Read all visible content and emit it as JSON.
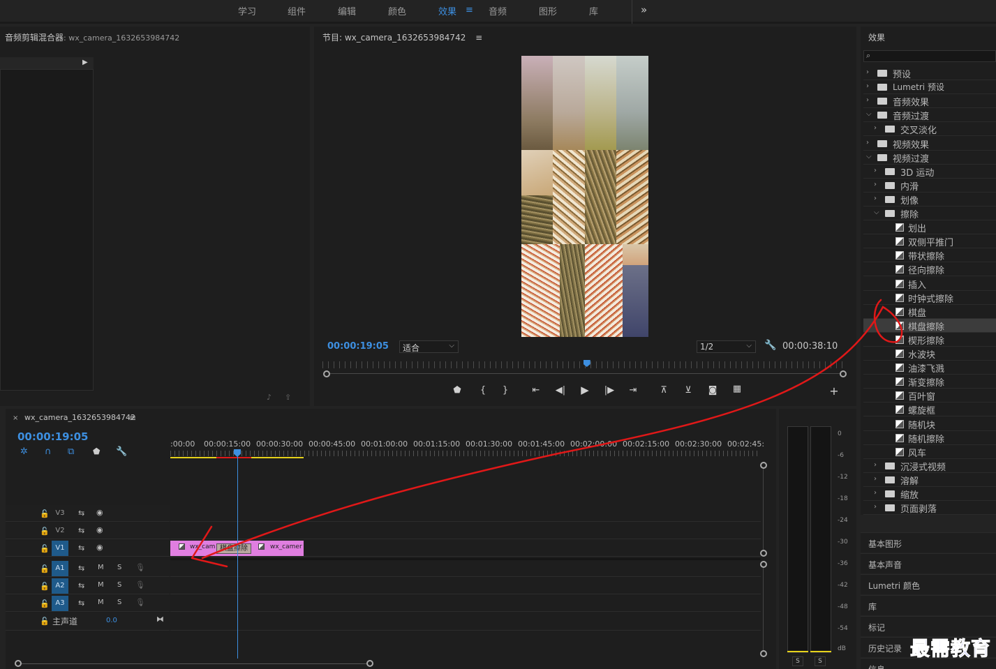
{
  "workspace": {
    "tabs": [
      {
        "label": "学习",
        "active": false
      },
      {
        "label": "组件",
        "active": false
      },
      {
        "label": "编辑",
        "active": false
      },
      {
        "label": "颜色",
        "active": false
      },
      {
        "label": "效果",
        "active": true
      },
      {
        "label": "音频",
        "active": false
      },
      {
        "label": "图形",
        "active": false
      },
      {
        "label": "库",
        "active": false
      }
    ],
    "menu_icon": "≡",
    "more_icon": "»"
  },
  "mixer": {
    "title": "音频剪辑混合器",
    "clip": ": wx_camera_1632653984742"
  },
  "program": {
    "title": "节目: wx_camera_1632653984742",
    "timecode": "00:00:19:05",
    "fit": "适合",
    "resolution": "1/2",
    "duration": "00:00:38:10",
    "playhead_fraction": 0.505
  },
  "timeline": {
    "sequence": "wx_camera_1632653984742",
    "timecode": "00:00:19:05",
    "ruler": [
      ":00:00",
      "00:00:15:00",
      "00:00:30:00",
      "00:00:45:00",
      "00:01:00:00",
      "00:01:15:00",
      "00:01:30:00",
      "00:01:45:00",
      "00:02:00:00",
      "00:02:15:00",
      "00:02:30:00",
      "00:02:45:"
    ],
    "video_tracks": [
      "V3",
      "V2",
      "V1"
    ],
    "audio_tracks": [
      "A1",
      "A2",
      "A3"
    ],
    "master_label": "主声道",
    "master_value": "0.0",
    "mute": "M",
    "solo": "S",
    "clips": [
      {
        "label": "wx_cam"
      },
      {
        "label": "wx_camer"
      }
    ],
    "transition_label": "棋盘擦除"
  },
  "meters": {
    "db_labels": [
      "0",
      "-6",
      "-12",
      "-18",
      "-24",
      "-30",
      "-36",
      "-42",
      "-48",
      "-54",
      "dB"
    ],
    "solo_left": "S",
    "solo_right": "S"
  },
  "effects": {
    "title": "效果",
    "search_placeholder": "",
    "tree": [
      {
        "label": "预设",
        "kind": "preset",
        "level": 0,
        "open": false
      },
      {
        "label": "Lumetri 预设",
        "kind": "preset",
        "level": 0,
        "open": false
      },
      {
        "label": "音频效果",
        "kind": "folder",
        "level": 0,
        "open": false
      },
      {
        "label": "音频过渡",
        "kind": "folder",
        "level": 0,
        "open": true
      },
      {
        "label": "交叉淡化",
        "kind": "folder",
        "level": 1,
        "open": false
      },
      {
        "label": "视频效果",
        "kind": "folder",
        "level": 0,
        "open": false
      },
      {
        "label": "视频过渡",
        "kind": "folder",
        "level": 0,
        "open": true
      },
      {
        "label": "3D 运动",
        "kind": "folder",
        "level": 1,
        "open": false
      },
      {
        "label": "内滑",
        "kind": "folder",
        "level": 1,
        "open": false
      },
      {
        "label": "划像",
        "kind": "folder",
        "level": 1,
        "open": false
      },
      {
        "label": "擦除",
        "kind": "folder",
        "level": 1,
        "open": true
      },
      {
        "label": "划出",
        "kind": "fx",
        "level": 2
      },
      {
        "label": "双侧平推门",
        "kind": "fx",
        "level": 2
      },
      {
        "label": "带状擦除",
        "kind": "fx",
        "level": 2
      },
      {
        "label": "径向擦除",
        "kind": "fx",
        "level": 2
      },
      {
        "label": "插入",
        "kind": "fx",
        "level": 2
      },
      {
        "label": "时钟式擦除",
        "kind": "fx",
        "level": 2
      },
      {
        "label": "棋盘",
        "kind": "fx",
        "level": 2
      },
      {
        "label": "棋盘擦除",
        "kind": "fx",
        "level": 2,
        "selected": true
      },
      {
        "label": "楔形擦除",
        "kind": "fx",
        "level": 2
      },
      {
        "label": "水波块",
        "kind": "fx",
        "level": 2
      },
      {
        "label": "油漆飞溅",
        "kind": "fx",
        "level": 2
      },
      {
        "label": "渐变擦除",
        "kind": "fx",
        "level": 2
      },
      {
        "label": "百叶窗",
        "kind": "fx",
        "level": 2
      },
      {
        "label": "螺旋框",
        "kind": "fx",
        "level": 2
      },
      {
        "label": "随机块",
        "kind": "fx",
        "level": 2
      },
      {
        "label": "随机擦除",
        "kind": "fx",
        "level": 2
      },
      {
        "label": "风车",
        "kind": "fx",
        "level": 2
      },
      {
        "label": "沉浸式视频",
        "kind": "folder",
        "level": 1,
        "open": false
      },
      {
        "label": "溶解",
        "kind": "folder",
        "level": 1,
        "open": false
      },
      {
        "label": "缩放",
        "kind": "folder",
        "level": 1,
        "open": false
      },
      {
        "label": "页面剥落",
        "kind": "folder",
        "level": 1,
        "open": false
      }
    ]
  },
  "side_panels": [
    "基本图形",
    "基本声音",
    "Lumetri 颜色",
    "库",
    "标记",
    "历史记录",
    "信息"
  ],
  "watermark": "最需教育",
  "colors": {
    "accent": "#3d8fe0",
    "clip": "#e07ee0",
    "annotation": "#e01818"
  }
}
